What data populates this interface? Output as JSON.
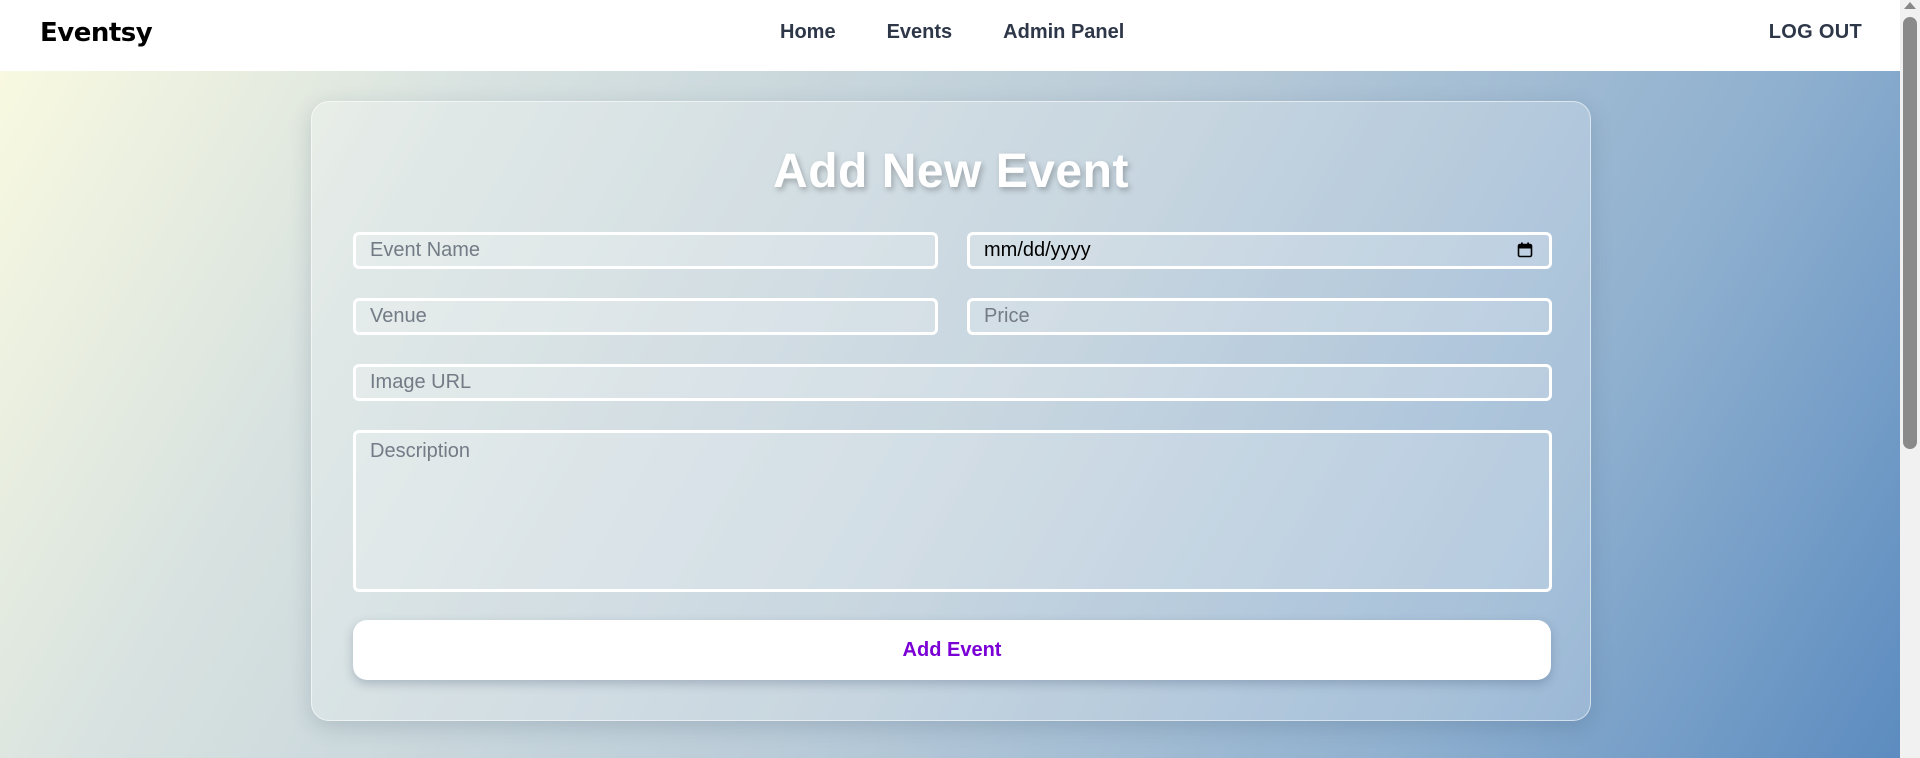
{
  "header": {
    "brand": "Eventsy",
    "nav": [
      "Home",
      "Events",
      "Admin Panel"
    ],
    "logout_label": "LOG OUT"
  },
  "form": {
    "title": "Add New Event",
    "event_name_placeholder": "Event Name",
    "date_value": "mm/dd/yyyy",
    "venue_placeholder": "Venue",
    "price_placeholder": "Price",
    "image_url_placeholder": "Image URL",
    "description_placeholder": "Description",
    "submit_label": "Add Event"
  },
  "icons": {
    "calendar": "calendar-icon"
  },
  "colors": {
    "submit_text": "#7a00d6",
    "nav_text": "#2d3748",
    "field_border": "#ffffff"
  }
}
